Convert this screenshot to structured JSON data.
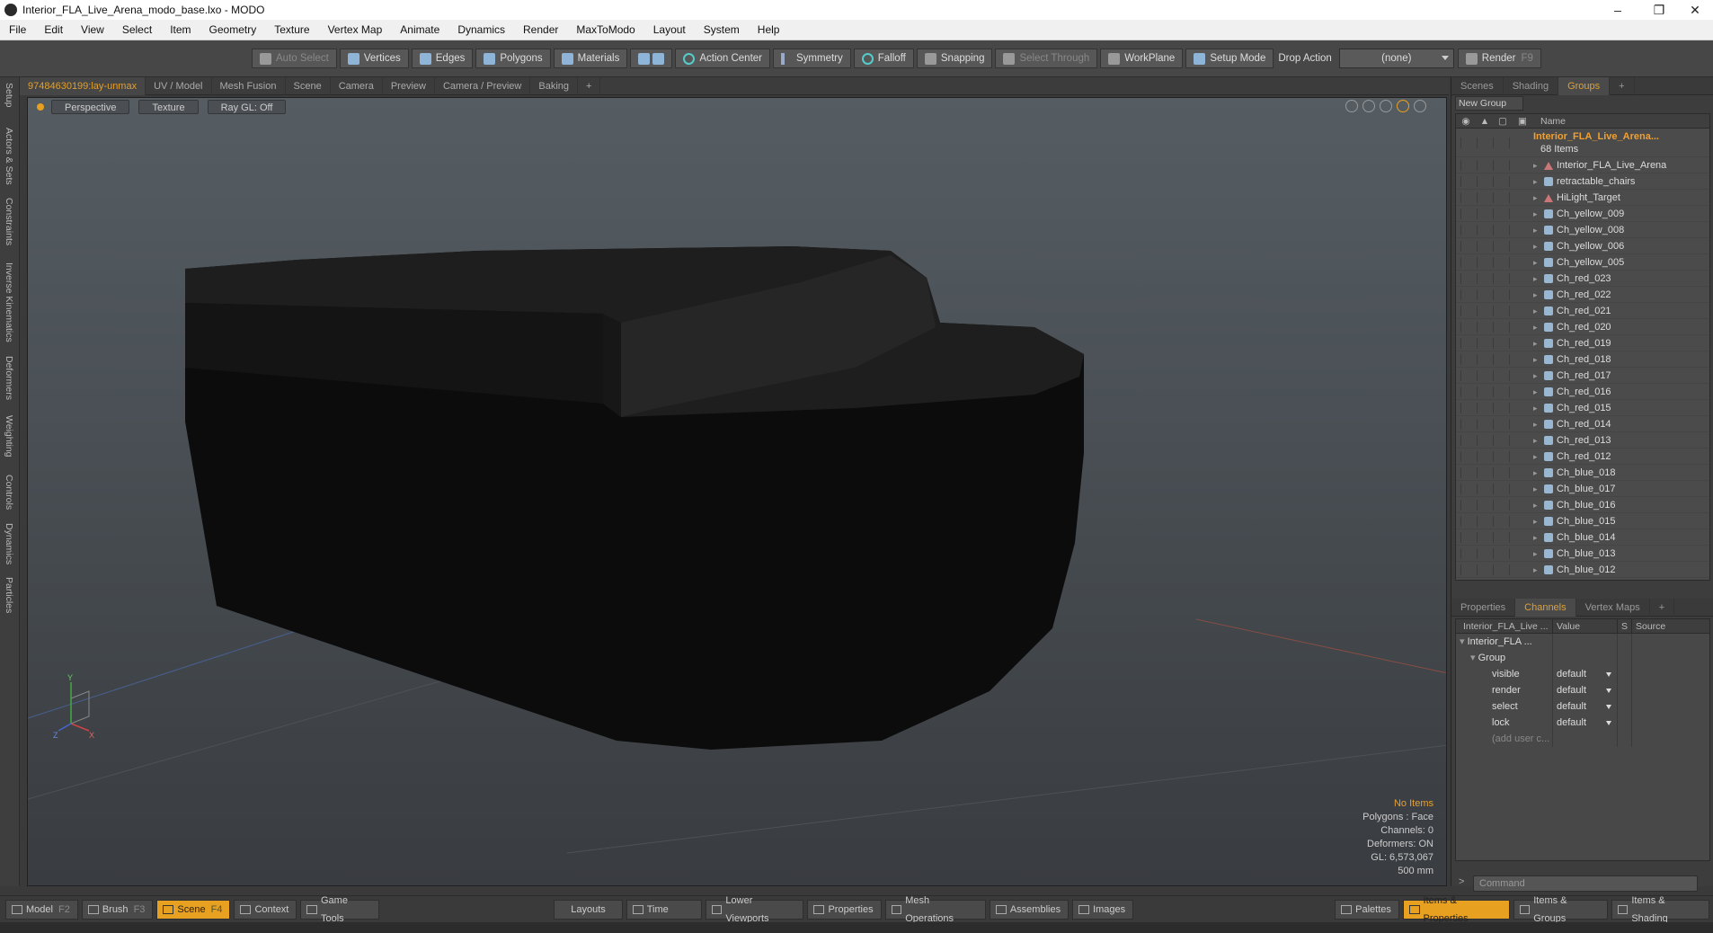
{
  "title": "Interior_FLA_Live_Arena_modo_base.lxo - MODO",
  "menu": [
    "File",
    "Edit",
    "View",
    "Select",
    "Item",
    "Geometry",
    "Texture",
    "Vertex Map",
    "Animate",
    "Dynamics",
    "Render",
    "MaxToModo",
    "Layout",
    "System",
    "Help"
  ],
  "toolbar": {
    "auto_select": "Auto Select",
    "vertices": "Vertices",
    "edges": "Edges",
    "polygons": "Polygons",
    "materials": "Materials",
    "action_center": "Action Center",
    "symmetry": "Symmetry",
    "falloff": "Falloff",
    "snapping": "Snapping",
    "select_through": "Select Through",
    "workplane": "WorkPlane",
    "setup_mode": "Setup Mode",
    "drop_action": "Drop Action",
    "drop_value": "(none)",
    "render": "Render",
    "render_key": "F9"
  },
  "left_tabs": [
    "Setup",
    "Actors & Sets",
    "Constraints",
    "Inverse Kinematics",
    "Deformers",
    "Weighting",
    "Controls",
    "Dynamics",
    "Particles"
  ],
  "viewport_tabs": [
    "97484630199:lay-unmax",
    "UV / Model",
    "Mesh Fusion",
    "Scene",
    "Camera",
    "Preview",
    "Camera / Preview",
    "Baking",
    "+"
  ],
  "viewport": {
    "perspective": "Perspective",
    "texture": "Texture",
    "raygl": "Ray GL: Off",
    "info": {
      "items": "No Items",
      "polygons": "Polygons : Face",
      "channels": "Channels: 0",
      "deformers": "Deformers: ON",
      "gl": "GL: 6,573,067",
      "scale": "500 mm"
    },
    "axis_labels": {
      "y": "Y",
      "x": "X",
      "z": "Z"
    }
  },
  "right_tabs_top": [
    "Scenes",
    "Shading",
    "Groups",
    "+"
  ],
  "groups": {
    "new_group": "New Group",
    "name_header": "Name",
    "root_name": "Interior_FLA_Live_Arena...",
    "root_count": "68 Items",
    "items": [
      {
        "name": "Interior_FLA_Live_Arena",
        "icon": "locator"
      },
      {
        "name": "retractable_chairs",
        "icon": "mesh"
      },
      {
        "name": "HiLight_Target",
        "icon": "locator"
      },
      {
        "name": "Ch_yellow_009",
        "icon": "mesh"
      },
      {
        "name": "Ch_yellow_008",
        "icon": "mesh"
      },
      {
        "name": "Ch_yellow_006",
        "icon": "mesh"
      },
      {
        "name": "Ch_yellow_005",
        "icon": "mesh"
      },
      {
        "name": "Ch_red_023",
        "icon": "mesh"
      },
      {
        "name": "Ch_red_022",
        "icon": "mesh"
      },
      {
        "name": "Ch_red_021",
        "icon": "mesh"
      },
      {
        "name": "Ch_red_020",
        "icon": "mesh"
      },
      {
        "name": "Ch_red_019",
        "icon": "mesh"
      },
      {
        "name": "Ch_red_018",
        "icon": "mesh"
      },
      {
        "name": "Ch_red_017",
        "icon": "mesh"
      },
      {
        "name": "Ch_red_016",
        "icon": "mesh"
      },
      {
        "name": "Ch_red_015",
        "icon": "mesh"
      },
      {
        "name": "Ch_red_014",
        "icon": "mesh"
      },
      {
        "name": "Ch_red_013",
        "icon": "mesh"
      },
      {
        "name": "Ch_red_012",
        "icon": "mesh"
      },
      {
        "name": "Ch_blue_018",
        "icon": "mesh"
      },
      {
        "name": "Ch_blue_017",
        "icon": "mesh"
      },
      {
        "name": "Ch_blue_016",
        "icon": "mesh"
      },
      {
        "name": "Ch_blue_015",
        "icon": "mesh"
      },
      {
        "name": "Ch_blue_014",
        "icon": "mesh"
      },
      {
        "name": "Ch_blue_013",
        "icon": "mesh"
      },
      {
        "name": "Ch_blue_012",
        "icon": "mesh"
      }
    ]
  },
  "right_tabs_bottom": [
    "Properties",
    "Channels",
    "Vertex Maps",
    "+"
  ],
  "channels": {
    "headers": [
      "Interior_FLA_Live ...",
      "Value",
      "S",
      "Source"
    ],
    "root": "Interior_FLA ...",
    "group": "Group",
    "rows": [
      {
        "name": "visible",
        "value": "default"
      },
      {
        "name": "render",
        "value": "default"
      },
      {
        "name": "select",
        "value": "default"
      },
      {
        "name": "lock",
        "value": "default"
      }
    ],
    "add_user": "(add user c..."
  },
  "command_placeholder": "Command",
  "bottom": {
    "model": "Model",
    "model_key": "F2",
    "brush": "Brush",
    "brush_key": "F3",
    "scene": "Scene",
    "scene_key": "F4",
    "context": "Context",
    "game_tools": "Game Tools",
    "layouts": "Layouts",
    "time": "Time",
    "lower_viewports": "Lower Viewports",
    "properties": "Properties",
    "mesh_operations": "Mesh Operations",
    "assemblies": "Assemblies",
    "images": "Images",
    "palettes": "Palettes",
    "items_properties": "Items & Properties",
    "items_groups": "Items & Groups",
    "items_shading": "Items & Shading"
  },
  "colors": {
    "accent": "#e8a020",
    "viewport_top": "#555d63",
    "viewport_bottom": "#393c40",
    "model": "#0d0d0d"
  }
}
